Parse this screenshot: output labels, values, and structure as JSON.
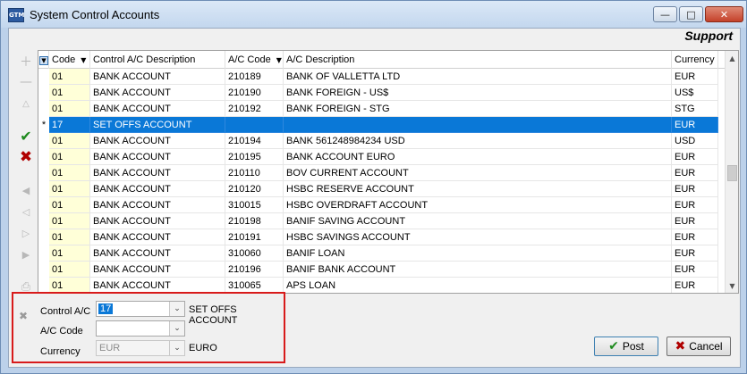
{
  "window": {
    "title": "System Control Accounts",
    "app_icon_text": "GTM",
    "section_label": "Support"
  },
  "grid": {
    "columns": [
      "Code",
      "Control A/C Description",
      "A/C Code",
      "A/C Description",
      "Currency"
    ],
    "rows": [
      {
        "code": "01",
        "desc": "BANK ACCOUNT",
        "ac_code": "210189",
        "ac_desc": "BANK OF VALLETTA LTD",
        "currency": "EUR",
        "indicator": ""
      },
      {
        "code": "01",
        "desc": "BANK ACCOUNT",
        "ac_code": "210190",
        "ac_desc": "BANK FOREIGN - US$",
        "currency": "US$",
        "indicator": ""
      },
      {
        "code": "01",
        "desc": "BANK ACCOUNT",
        "ac_code": "210192",
        "ac_desc": "BANK FOREIGN - STG",
        "currency": "STG",
        "indicator": ""
      },
      {
        "code": "17",
        "desc": "SET OFFS ACCOUNT",
        "ac_code": "",
        "ac_desc": "",
        "currency": "EUR",
        "indicator": "*",
        "selected": true
      },
      {
        "code": "01",
        "desc": "BANK ACCOUNT",
        "ac_code": "210194",
        "ac_desc": "BANK 561248984234 USD",
        "currency": "USD",
        "indicator": ""
      },
      {
        "code": "01",
        "desc": "BANK ACCOUNT",
        "ac_code": "210195",
        "ac_desc": "BANK ACCOUNT EURO",
        "currency": "EUR",
        "indicator": ""
      },
      {
        "code": "01",
        "desc": "BANK ACCOUNT",
        "ac_code": "210110",
        "ac_desc": "BOV CURRENT ACCOUNT",
        "currency": "EUR",
        "indicator": ""
      },
      {
        "code": "01",
        "desc": "BANK ACCOUNT",
        "ac_code": "210120",
        "ac_desc": "HSBC RESERVE ACCOUNT",
        "currency": "EUR",
        "indicator": ""
      },
      {
        "code": "01",
        "desc": "BANK ACCOUNT",
        "ac_code": "310015",
        "ac_desc": "HSBC OVERDRAFT ACCOUNT",
        "currency": "EUR",
        "indicator": ""
      },
      {
        "code": "01",
        "desc": "BANK ACCOUNT",
        "ac_code": "210198",
        "ac_desc": "BANIF SAVING ACCOUNT",
        "currency": "EUR",
        "indicator": ""
      },
      {
        "code": "01",
        "desc": "BANK ACCOUNT",
        "ac_code": "210191",
        "ac_desc": "HSBC SAVINGS ACCOUNT",
        "currency": "EUR",
        "indicator": ""
      },
      {
        "code": "01",
        "desc": "BANK ACCOUNT",
        "ac_code": "310060",
        "ac_desc": "BANIF LOAN",
        "currency": "EUR",
        "indicator": ""
      },
      {
        "code": "01",
        "desc": "BANK ACCOUNT",
        "ac_code": "210196",
        "ac_desc": "BANIF BANK ACCOUNT",
        "currency": "EUR",
        "indicator": ""
      },
      {
        "code": "01",
        "desc": "BANK ACCOUNT",
        "ac_code": "310065",
        "ac_desc": "APS LOAN",
        "currency": "EUR",
        "indicator": ""
      }
    ]
  },
  "form": {
    "control_ac_label": "Control A/C",
    "control_ac_value": "17",
    "control_ac_desc": "SET OFFS ACCOUNT",
    "ac_code_label": "A/C Code",
    "ac_code_value": "",
    "currency_label": "Currency",
    "currency_value": "EUR",
    "currency_desc": "EURO"
  },
  "buttons": {
    "post": "Post",
    "cancel": "Cancel"
  },
  "icons": {
    "add": "plus-icon",
    "remove": "minus-icon",
    "up": "triangle-up-icon",
    "confirm": "checkmark-icon",
    "discard": "cross-icon",
    "first": "first-record-icon",
    "prev": "prev-record-icon",
    "next": "next-record-icon",
    "last": "last-record-icon",
    "print": "printer-icon"
  },
  "colors": {
    "selection": "#0a78d7",
    "code_cell": "#ffffd8",
    "highlight_border": "#d81b1b",
    "check": "#1e8a1e",
    "cross": "#b00000"
  }
}
